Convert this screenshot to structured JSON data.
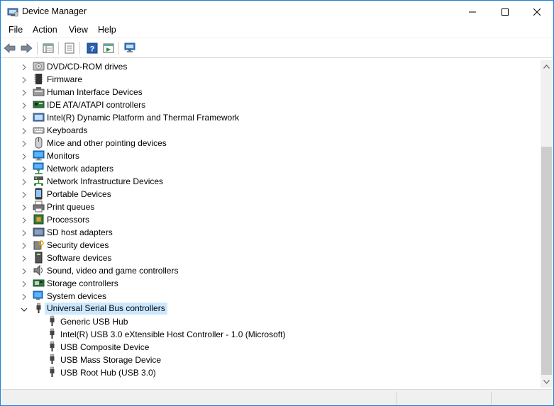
{
  "window": {
    "title": "Device Manager",
    "accent": "#1883d7"
  },
  "menu": [
    "File",
    "Action",
    "View",
    "Help"
  ],
  "toolbar_icons": [
    "back-arrow-icon",
    "forward-arrow-icon",
    "show-hidden-icon",
    "properties-icon",
    "help-icon",
    "run-icon",
    "scan-hardware-icon"
  ],
  "tree": {
    "categories": [
      {
        "label": "DVD/CD-ROM drives",
        "icon": "dvd-drive-icon"
      },
      {
        "label": "Firmware",
        "icon": "firmware-icon"
      },
      {
        "label": "Human Interface Devices",
        "icon": "hid-icon"
      },
      {
        "label": "IDE ATA/ATAPI controllers",
        "icon": "ide-controller-icon"
      },
      {
        "label": "Intel(R) Dynamic Platform and Thermal Framework",
        "icon": "intel-platform-icon"
      },
      {
        "label": "Keyboards",
        "icon": "keyboard-icon"
      },
      {
        "label": "Mice and other pointing devices",
        "icon": "mouse-icon"
      },
      {
        "label": "Monitors",
        "icon": "monitor-icon"
      },
      {
        "label": "Network adapters",
        "icon": "network-adapter-icon"
      },
      {
        "label": "Network Infrastructure Devices",
        "icon": "network-infrastructure-icon"
      },
      {
        "label": "Portable Devices",
        "icon": "portable-device-icon"
      },
      {
        "label": "Print queues",
        "icon": "printer-icon"
      },
      {
        "label": "Processors",
        "icon": "processor-icon"
      },
      {
        "label": "SD host adapters",
        "icon": "sd-adapter-icon"
      },
      {
        "label": "Security devices",
        "icon": "security-device-icon"
      },
      {
        "label": "Software devices",
        "icon": "software-device-icon"
      },
      {
        "label": "Sound, video and game controllers",
        "icon": "sound-icon"
      },
      {
        "label": "Storage controllers",
        "icon": "storage-controller-icon"
      },
      {
        "label": "System devices",
        "icon": "system-device-icon"
      },
      {
        "label": "Universal Serial Bus controllers",
        "icon": "usb-icon",
        "expanded": true,
        "selected": true
      }
    ],
    "usb_children": [
      "Generic USB Hub",
      "Intel(R) USB 3.0 eXtensible Host Controller - 1.0 (Microsoft)",
      "USB Composite Device",
      "USB Mass Storage Device",
      "USB Root Hub (USB 3.0)"
    ]
  },
  "colors": {
    "selection": "#cce8ff",
    "scroll_thumb": "#cdcdcd"
  }
}
